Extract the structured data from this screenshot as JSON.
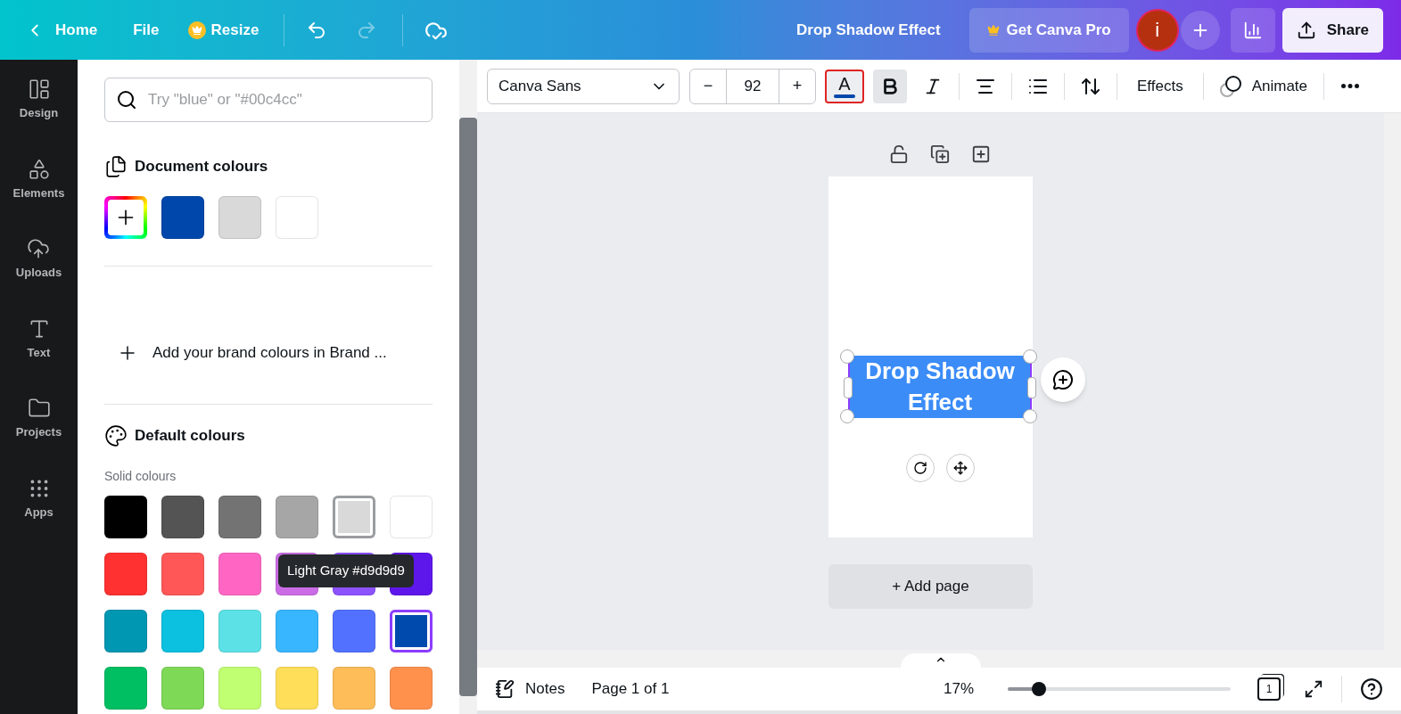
{
  "topbar": {
    "back": "Home",
    "menu": [
      "File",
      "Resize"
    ],
    "title": "Drop Shadow Effect",
    "pro_button": "Get Canva Pro",
    "avatar": "i",
    "share": "Share"
  },
  "sidebar": {
    "items": [
      {
        "label": "Design",
        "kind": "design"
      },
      {
        "label": "Elements",
        "kind": "elements"
      },
      {
        "label": "Uploads",
        "kind": "uploads"
      },
      {
        "label": "Text",
        "kind": "text"
      },
      {
        "label": "Projects",
        "kind": "projects"
      },
      {
        "label": "Apps",
        "kind": "apps"
      }
    ]
  },
  "panel": {
    "search": {
      "placeholder": "Try \"blue\" or \"#00c4cc\""
    },
    "document_colours": {
      "title": "Document colours",
      "swatches": [
        {
          "color": "#0047ab"
        },
        {
          "color": "#d9d9d9"
        },
        {
          "color": "#ffffff"
        }
      ]
    },
    "brand_link": "Add your brand colours in Brand ...",
    "default_colours": {
      "title": "Default colours",
      "subtitle": "Solid colours",
      "swatches": [
        {
          "color": "#000000",
          "selected": false,
          "hovered": false
        },
        {
          "color": "#545454",
          "selected": false,
          "hovered": false
        },
        {
          "color": "#737373",
          "selected": false,
          "hovered": false
        },
        {
          "color": "#a6a6a6",
          "selected": false,
          "hovered": false
        },
        {
          "color": "#d9d9d9",
          "selected": false,
          "hovered": true
        },
        {
          "color": "#ffffff",
          "selected": false,
          "hovered": false
        },
        {
          "color": "#ff3131",
          "selected": false,
          "hovered": false
        },
        {
          "color": "#ff5757",
          "selected": false,
          "hovered": false
        },
        {
          "color": "#ff66c4",
          "selected": false,
          "hovered": false
        },
        {
          "color": "#cb6ce6",
          "selected": false,
          "hovered": false
        },
        {
          "color": "#8c52ff",
          "selected": false,
          "hovered": false
        },
        {
          "color": "#5e17eb",
          "selected": false,
          "hovered": false
        },
        {
          "color": "#0097b2",
          "selected": false,
          "hovered": false
        },
        {
          "color": "#0cc0df",
          "selected": false,
          "hovered": false
        },
        {
          "color": "#5ce1e6",
          "selected": false,
          "hovered": false
        },
        {
          "color": "#38b6ff",
          "selected": false,
          "hovered": false
        },
        {
          "color": "#5271ff",
          "selected": false,
          "hovered": false
        },
        {
          "color": "#004aad",
          "selected": true,
          "hovered": false
        },
        {
          "color": "#00bf63",
          "selected": false,
          "hovered": false
        },
        {
          "color": "#7ed957",
          "selected": false,
          "hovered": false
        },
        {
          "color": "#c1ff72",
          "selected": false,
          "hovered": false
        },
        {
          "color": "#ffde59",
          "selected": false,
          "hovered": false
        },
        {
          "color": "#ffbd59",
          "selected": false,
          "hovered": false
        },
        {
          "color": "#ff914d",
          "selected": false,
          "hovered": false
        }
      ]
    },
    "tooltip": "Light Gray #d9d9d9"
  },
  "toolbar": {
    "font": "Canva Sans",
    "decrease": "−",
    "size": "92",
    "increase": "+",
    "text_color_glyph": "A",
    "text_color_active": true,
    "effects": "Effects",
    "animate": "Animate"
  },
  "canvas": {
    "text": "Drop Shadow Effect",
    "add_page": "+ Add page"
  },
  "bottom_bar": {
    "notes": "Notes",
    "page": "Page 1 of 1",
    "zoom": "17%",
    "zoom_slider": {
      "level": 0.14
    },
    "page_count": "1"
  }
}
